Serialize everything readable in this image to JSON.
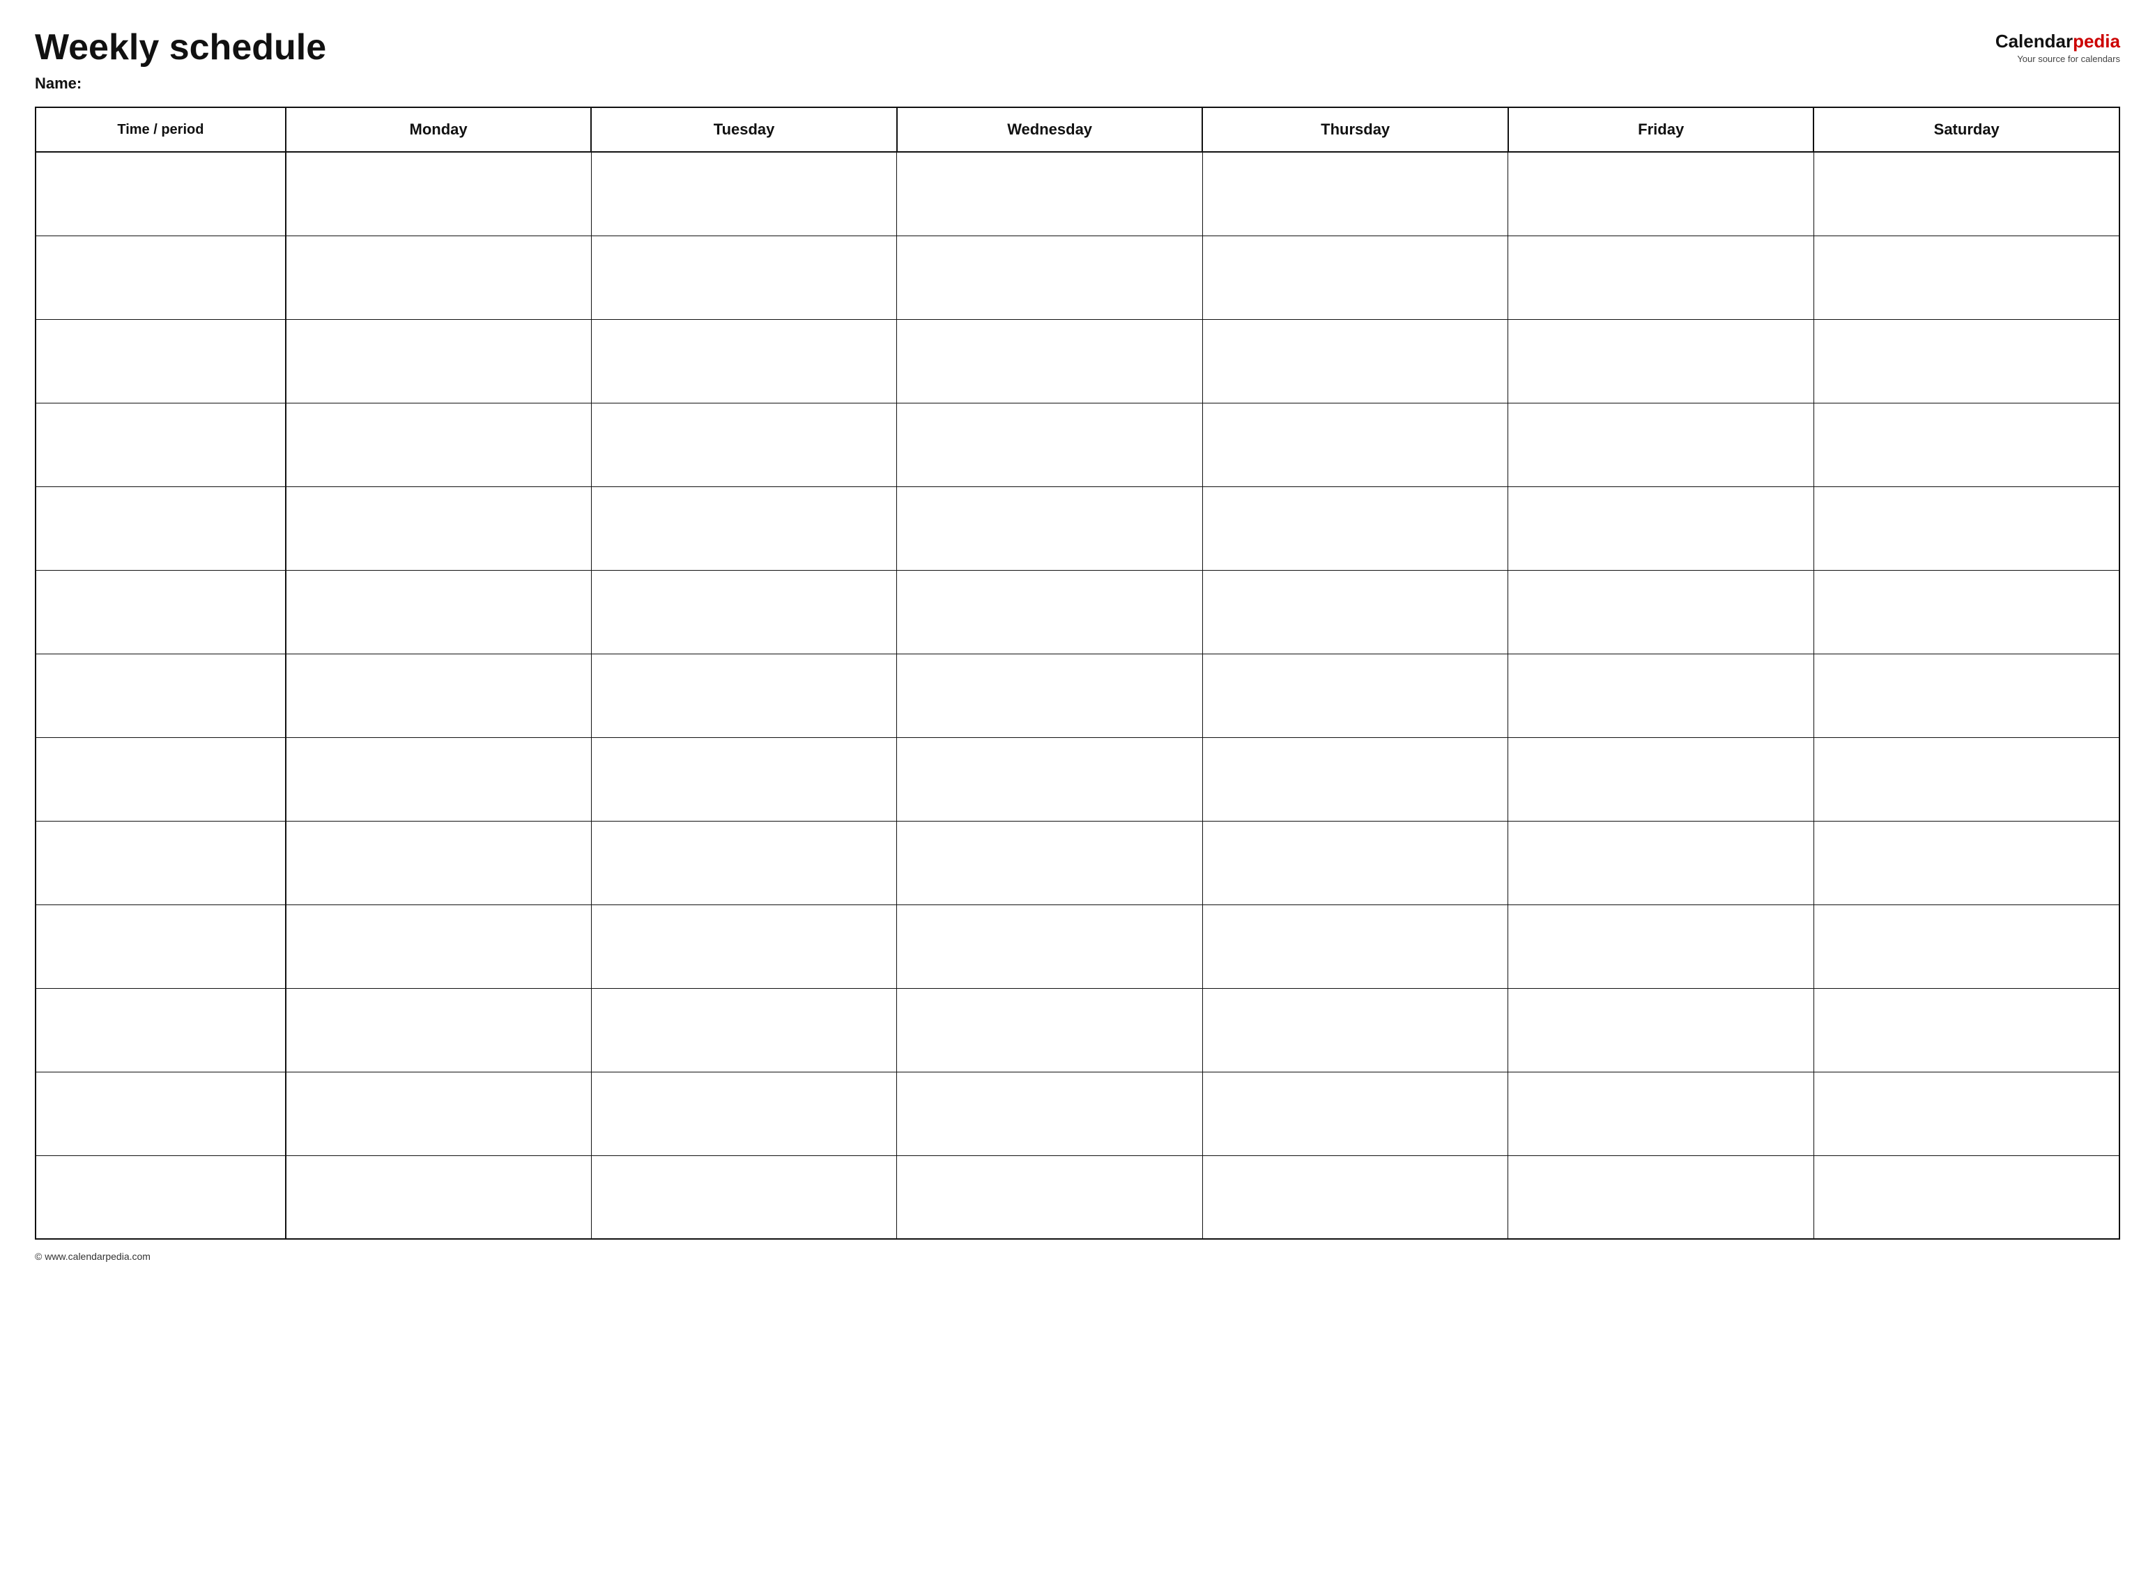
{
  "header": {
    "main_title": "Weekly schedule",
    "name_label": "Name:",
    "logo": {
      "calendar_text": "Calendar",
      "pedia_text": "pedia",
      "tagline": "Your source for calendars"
    }
  },
  "table": {
    "columns": [
      {
        "label": "Time / period",
        "type": "time"
      },
      {
        "label": "Monday",
        "type": "day"
      },
      {
        "label": "Tuesday",
        "type": "day"
      },
      {
        "label": "Wednesday",
        "type": "day"
      },
      {
        "label": "Thursday",
        "type": "day"
      },
      {
        "label": "Friday",
        "type": "day"
      },
      {
        "label": "Saturday",
        "type": "day"
      }
    ],
    "row_count": 13
  },
  "footer": {
    "copyright": "© www.calendarpedia.com"
  }
}
